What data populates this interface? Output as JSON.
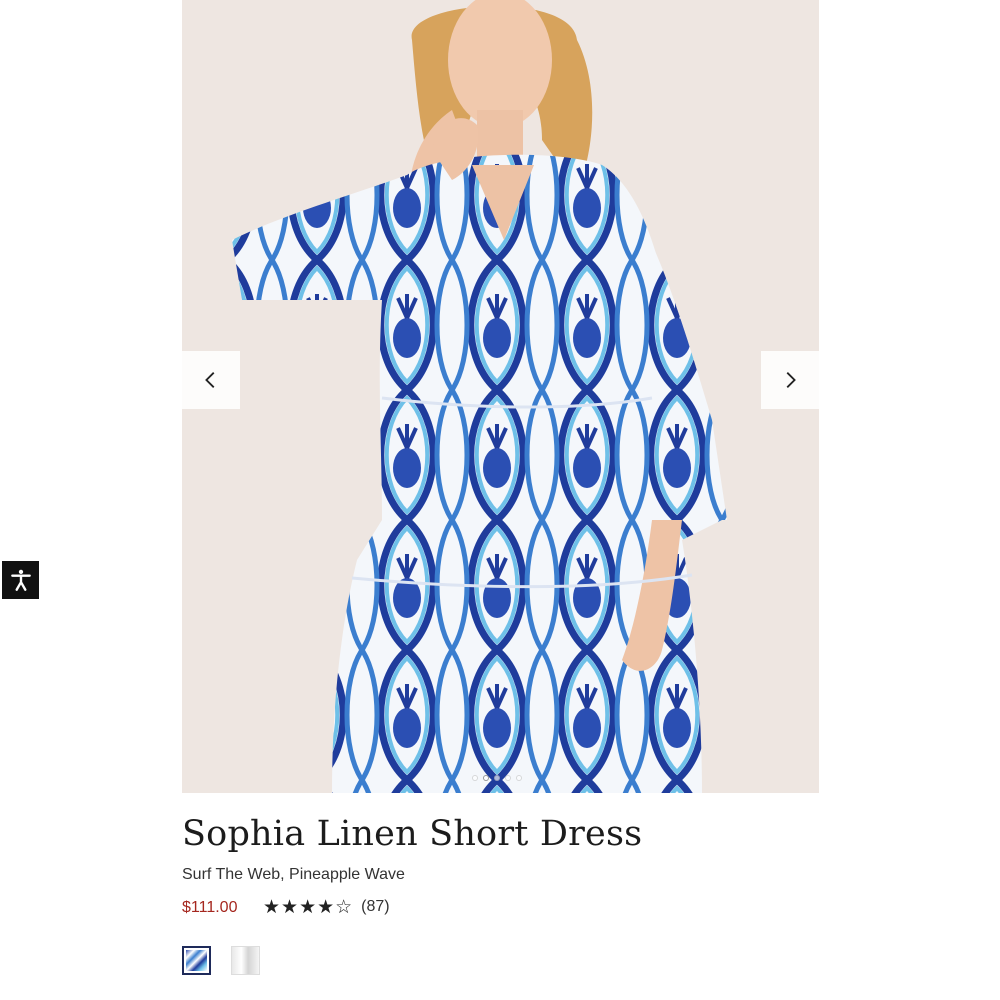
{
  "product": {
    "title": "Sophia Linen Short Dress",
    "color_name": "Surf The Web, Pineapple Wave",
    "price": "$111.00",
    "rating": {
      "stars_display": "★★★★☆",
      "value": 4,
      "max": 5,
      "review_count": "(87)"
    }
  },
  "gallery": {
    "image_count": 5,
    "active_index": 1,
    "prev_icon": "chevron-left-icon",
    "next_icon": "chevron-right-icon"
  },
  "swatches": [
    {
      "name": "Surf The Web, Pineapple Wave",
      "selected": true
    },
    {
      "name": "white",
      "selected": false
    }
  ],
  "accessibility": {
    "icon": "accessibility-icon"
  },
  "colors": {
    "price": "#a5271f",
    "dress_navy": "#1f3c9c",
    "dress_blue": "#3b7ecf",
    "dress_turquoise": "#6ec0e8",
    "background": "#efe7e2"
  }
}
